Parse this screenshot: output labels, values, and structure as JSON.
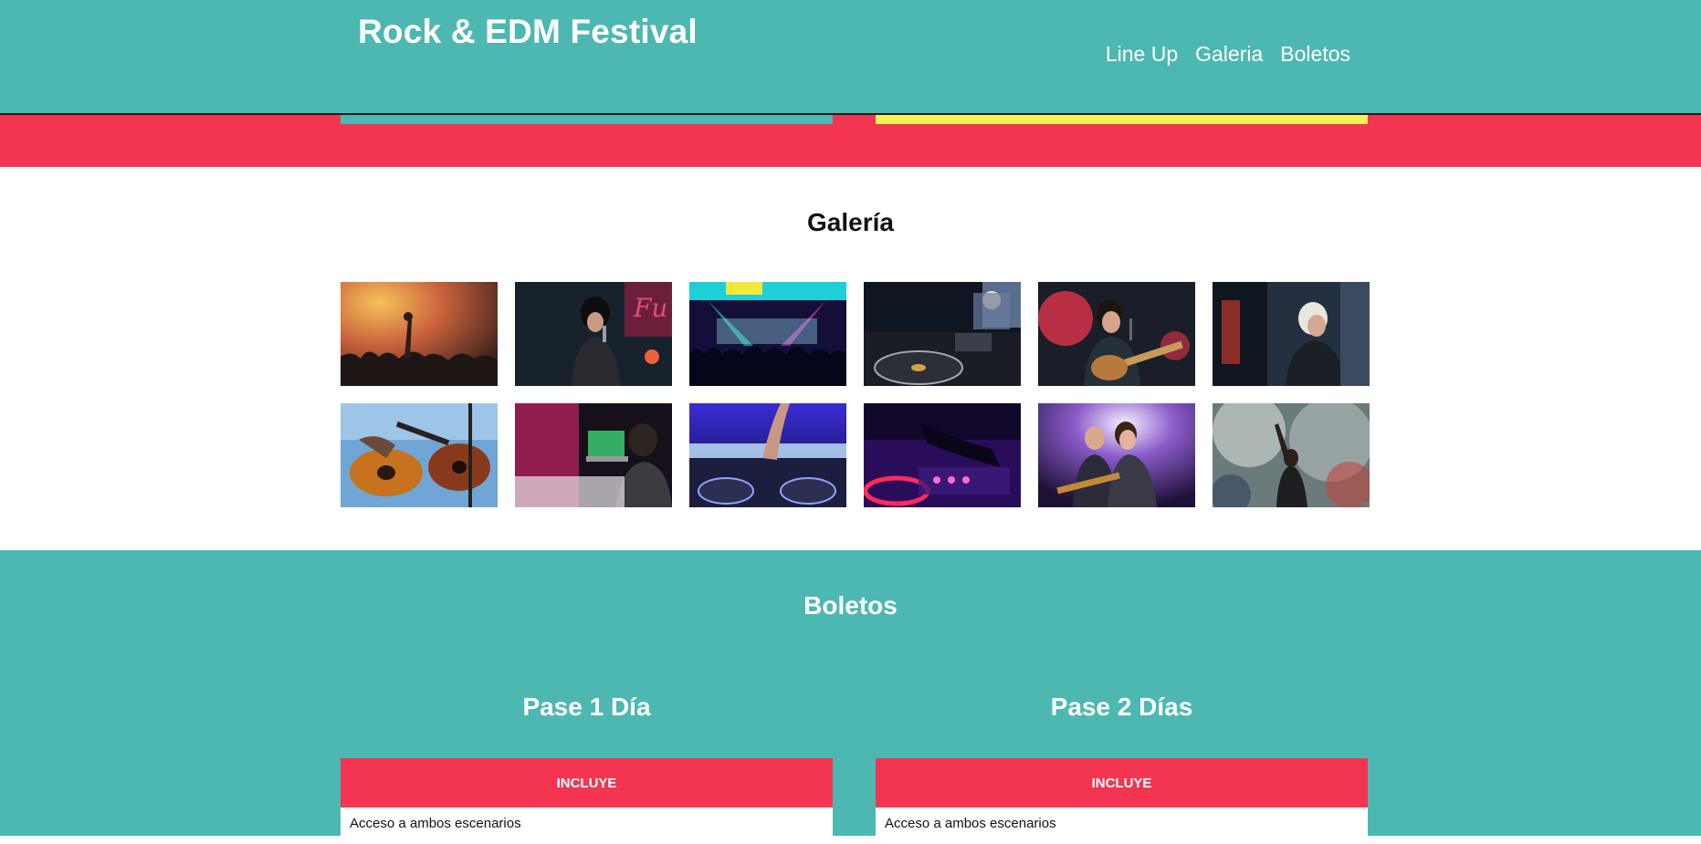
{
  "header": {
    "title": "Rock & EDM Festival",
    "nav": [
      "Line Up",
      "Galeria",
      "Boletos"
    ]
  },
  "colors": {
    "teal": "#4db8b2",
    "red": "#f33552",
    "yellow": "#f5f255",
    "white": "#ffffff"
  },
  "gallery": {
    "title": "Galería",
    "images": [
      "crowd-hands-stage-photo",
      "singer-microphone-photo",
      "concert-crowd-lights-photo",
      "dj-turntables-photo",
      "guitarist-singing-photo",
      "dj-headphones-photo",
      "guitar-players-photo",
      "dj-laptop-booth-photo",
      "dj-mixer-blue-photo",
      "dj-controller-purple-photo",
      "rock-duo-stage-photo",
      "performer-smoke-photo"
    ]
  },
  "tickets": {
    "title": "Boletos",
    "passes": [
      {
        "name": "Pase 1 Día",
        "header": "INCLUYE",
        "items": [
          "Acceso a ambos escenarios"
        ]
      },
      {
        "name": "Pase 2 Días",
        "header": "INCLUYE",
        "items": [
          "Acceso a ambos escenarios"
        ]
      }
    ]
  }
}
